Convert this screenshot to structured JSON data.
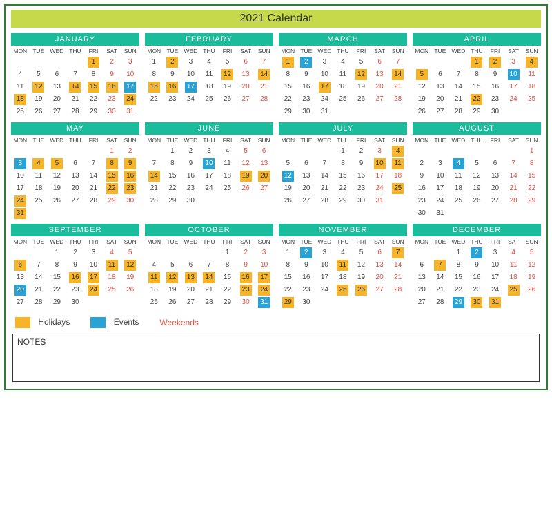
{
  "title": "2021 Calendar",
  "dow": [
    "MON",
    "TUE",
    "WED",
    "THU",
    "FRI",
    "SAT",
    "SUN"
  ],
  "legend": {
    "holidays": "Holidays",
    "events": "Events",
    "weekends": "Weekends"
  },
  "notes_label": "NOTES",
  "months": [
    {
      "name": "JANUARY",
      "startCol": 4,
      "days": 31,
      "holidays": [
        1,
        12,
        14,
        15,
        16,
        18,
        24
      ],
      "events": [
        17
      ]
    },
    {
      "name": "FEBRUARY",
      "startCol": 0,
      "days": 28,
      "holidays": [
        2,
        12,
        14,
        15,
        16
      ],
      "events": [
        17
      ]
    },
    {
      "name": "MARCH",
      "startCol": 0,
      "days": 31,
      "holidays": [
        1,
        12,
        14,
        17
      ],
      "events": [
        2
      ]
    },
    {
      "name": "APRIL",
      "startCol": 3,
      "days": 30,
      "holidays": [
        1,
        2,
        4,
        5,
        22
      ],
      "events": [
        10
      ]
    },
    {
      "name": "MAY",
      "startCol": 5,
      "days": 31,
      "holidays": [
        4,
        5,
        8,
        9,
        15,
        16,
        22,
        23,
        24,
        31
      ],
      "events": [
        3
      ]
    },
    {
      "name": "JUNE",
      "startCol": 1,
      "days": 30,
      "holidays": [
        14,
        19,
        20
      ],
      "events": [
        10
      ]
    },
    {
      "name": "JULY",
      "startCol": 3,
      "days": 31,
      "holidays": [
        4,
        10,
        11,
        25
      ],
      "events": [
        12
      ]
    },
    {
      "name": "AUGUST",
      "startCol": 6,
      "days": 31,
      "holidays": [],
      "events": [
        4
      ]
    },
    {
      "name": "SEPTEMBER",
      "startCol": 2,
      "days": 30,
      "holidays": [
        6,
        11,
        12,
        16,
        17,
        24
      ],
      "events": [
        20
      ]
    },
    {
      "name": "OCTOBER",
      "startCol": 4,
      "days": 31,
      "holidays": [
        11,
        12,
        13,
        14,
        16,
        17,
        23,
        24
      ],
      "events": [
        31
      ]
    },
    {
      "name": "NOVEMBER",
      "startCol": 0,
      "days": 30,
      "holidays": [
        7,
        11,
        25,
        26,
        29
      ],
      "events": [
        2
      ]
    },
    {
      "name": "DECEMBER",
      "startCol": 2,
      "days": 31,
      "holidays": [
        7,
        25,
        30,
        31
      ],
      "events": [
        2,
        29
      ]
    }
  ]
}
